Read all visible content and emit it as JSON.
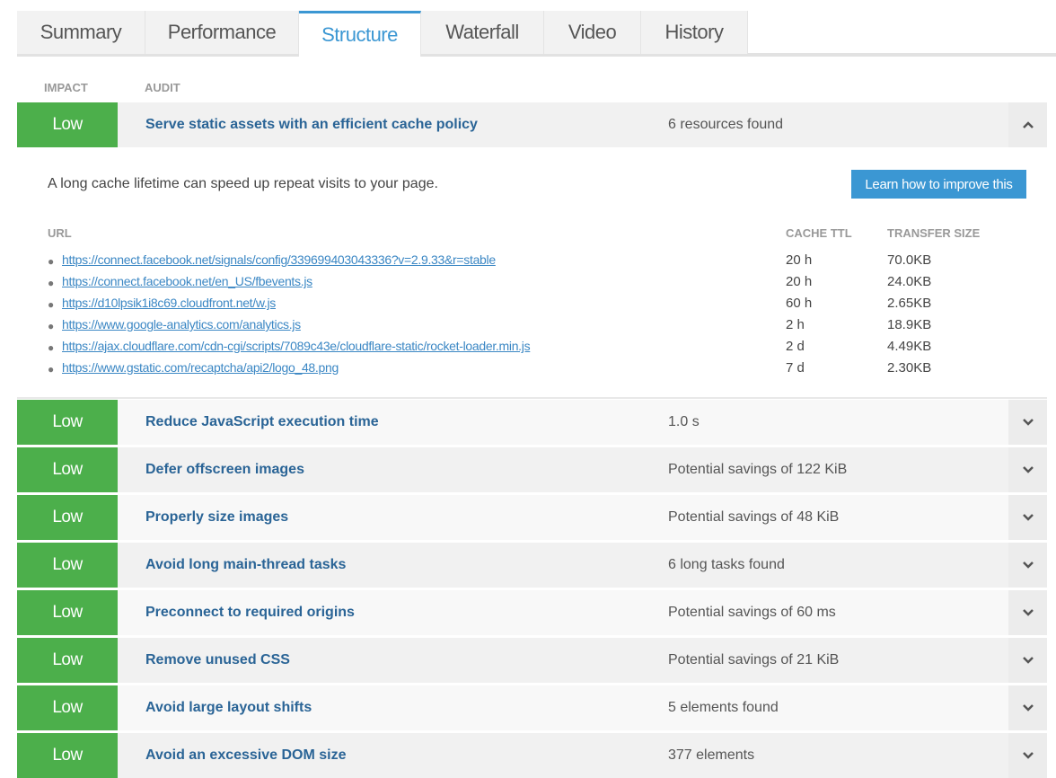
{
  "tabs": [
    "Summary",
    "Performance",
    "Structure",
    "Waterfall",
    "Video",
    "History"
  ],
  "active_tab": "Structure",
  "headers": {
    "impact": "IMPACT",
    "audit": "AUDIT"
  },
  "expanded": {
    "impact": "Low",
    "title": "Serve static assets with an efficient cache policy",
    "value": "6 resources found",
    "description": "A long cache lifetime can speed up repeat visits to your page.",
    "button": "Learn how to improve this",
    "columns": {
      "url": "URL",
      "ttl": "CACHE TTL",
      "size": "TRANSFER SIZE"
    },
    "resources": [
      {
        "url": "https://connect.facebook.net/signals/config/339699403043336?v=2.9.33&r=stable",
        "ttl": "20 h",
        "size": "70.0KB"
      },
      {
        "url": "https://connect.facebook.net/en_US/fbevents.js",
        "ttl": "20 h",
        "size": "24.0KB"
      },
      {
        "url": "https://d10lpsik1i8c69.cloudfront.net/w.js",
        "ttl": "60 h",
        "size": "2.65KB"
      },
      {
        "url": "https://www.google-analytics.com/analytics.js",
        "ttl": "2 h",
        "size": "18.9KB"
      },
      {
        "url": "https://ajax.cloudflare.com/cdn-cgi/scripts/7089c43e/cloudflare-static/rocket-loader.min.js",
        "ttl": "2 d",
        "size": "4.49KB"
      },
      {
        "url": "https://www.gstatic.com/recaptcha/api2/logo_48.png",
        "ttl": "7 d",
        "size": "2.30KB"
      }
    ]
  },
  "audits": [
    {
      "impact": "Low",
      "title": "Reduce JavaScript execution time",
      "value": "1.0 s"
    },
    {
      "impact": "Low",
      "title": "Defer offscreen images",
      "value": "Potential savings of 122 KiB"
    },
    {
      "impact": "Low",
      "title": "Properly size images",
      "value": "Potential savings of 48 KiB"
    },
    {
      "impact": "Low",
      "title": "Avoid long main-thread tasks",
      "value": "6 long tasks found"
    },
    {
      "impact": "Low",
      "title": "Preconnect to required origins",
      "value": "Potential savings of 60 ms"
    },
    {
      "impact": "Low",
      "title": "Remove unused CSS",
      "value": "Potential savings of 21 KiB"
    },
    {
      "impact": "Low",
      "title": "Avoid large layout shifts",
      "value": "5 elements found"
    },
    {
      "impact": "Low",
      "title": "Avoid an excessive DOM size",
      "value": "377 elements"
    }
  ],
  "colors": {
    "impact_low": "#4caf4b",
    "accent": "#3b97d3",
    "audit_title": "#2a6496"
  }
}
